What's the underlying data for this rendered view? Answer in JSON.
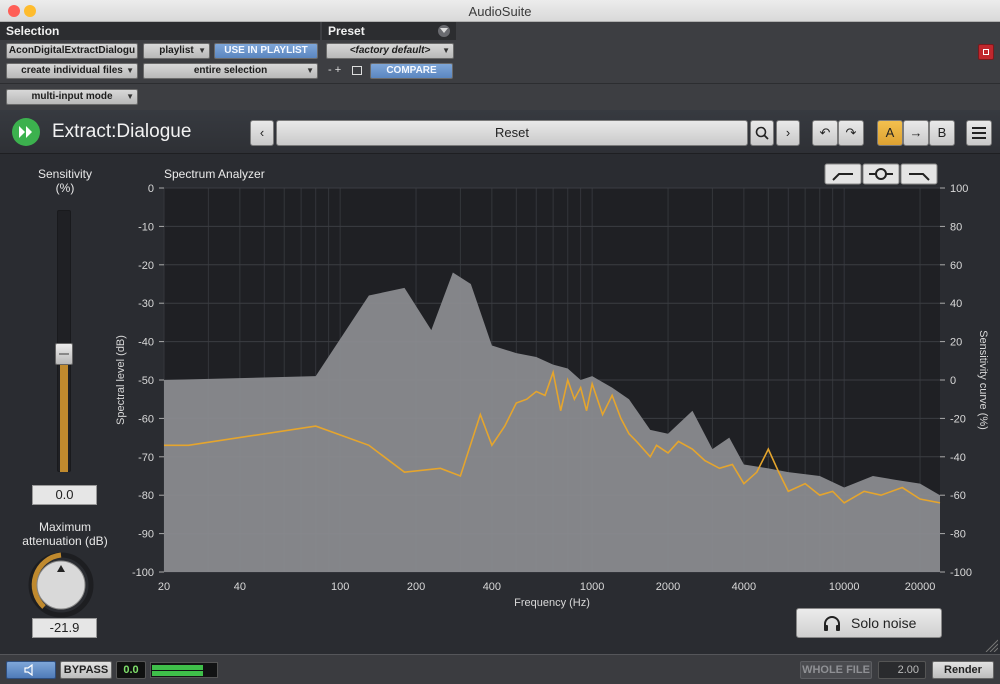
{
  "window": {
    "title": "AudioSuite"
  },
  "header": {
    "selection_label": "Selection",
    "preset_label": "Preset",
    "plugin_select": "AconDigitalExtractDialogu",
    "playlist_select": "playlist",
    "use_in_playlist": "USE IN PLAYLIST",
    "file_mode": "create individual files",
    "selection_mode": "entire selection",
    "preset_select": "<factory default>",
    "preset_controls": "- +",
    "compare": "COMPARE",
    "input_mode": "multi-input mode"
  },
  "plugin": {
    "name": "Extract:Dialogue",
    "preset_name": "Reset",
    "ab": {
      "a": "A",
      "arrow": "→",
      "b": "B"
    },
    "sensitivity": {
      "label_line1": "Sensitivity",
      "label_line2": "(%)",
      "value": "0.0",
      "level": 0.45
    },
    "max_attenuation": {
      "label_line1": "Maximum",
      "label_line2": "attenuation (dB)",
      "value": "-21.9"
    },
    "solo_noise": "Solo noise"
  },
  "chart_data": {
    "type": "area",
    "title": "Spectrum Analyzer",
    "xlabel": "Frequency (Hz)",
    "ylabel": "Spectral level (dB)",
    "y2label": "Sensitivity curve (%)",
    "x_scale": "log",
    "xlim": [
      20,
      24000
    ],
    "ylim": [
      -100,
      0
    ],
    "y2lim": [
      -100,
      100
    ],
    "x_ticks": [
      {
        "v": 20,
        "label": "20"
      },
      {
        "v": 40,
        "label": "40"
      },
      {
        "v": 100,
        "label": "100"
      },
      {
        "v": 200,
        "label": "200"
      },
      {
        "v": 400,
        "label": "400"
      },
      {
        "v": 1000,
        "label": "1000"
      },
      {
        "v": 2000,
        "label": "2000"
      },
      {
        "v": 4000,
        "label": "4000"
      },
      {
        "v": 10000,
        "label": "10000"
      },
      {
        "v": 20000,
        "label": "20000"
      }
    ],
    "y_ticks": [
      "0",
      "-10",
      "-20",
      "-30",
      "-40",
      "-50",
      "-60",
      "-70",
      "-80",
      "-90",
      "-100"
    ],
    "y2_ticks": [
      "100",
      "80",
      "60",
      "40",
      "20",
      "0",
      "-20",
      "-40",
      "-60",
      "-80",
      "-100"
    ],
    "grid": true,
    "series": [
      {
        "color": "#8a8b8f",
        "x": [
          20,
          80,
          130,
          180,
          230,
          280,
          330,
          400,
          500,
          600,
          700,
          800,
          900,
          1000,
          1200,
          1400,
          1700,
          2000,
          2500,
          3000,
          3500,
          4000,
          5000,
          6000,
          8000,
          10000,
          13000,
          16000,
          20000,
          24000
        ],
        "values": [
          -50,
          -49,
          -28,
          -26,
          -37,
          -22,
          -25,
          -41,
          -43,
          -44,
          -46,
          -47,
          -50,
          -49,
          -52,
          -55,
          -63,
          -64,
          -58,
          -68,
          -65,
          -72,
          -73,
          -74,
          -75,
          -78,
          -75,
          -76,
          -77,
          -80
        ]
      },
      {
        "color": "#e5a52d",
        "x": [
          20,
          25,
          80,
          130,
          180,
          250,
          300,
          360,
          400,
          450,
          500,
          550,
          600,
          650,
          700,
          750,
          800,
          850,
          900,
          950,
          1000,
          1100,
          1200,
          1300,
          1400,
          1500,
          1700,
          1800,
          2000,
          2200,
          2500,
          2800,
          3200,
          3600,
          4000,
          4500,
          5000,
          5500,
          6000,
          7000,
          8000,
          9000,
          10000,
          12000,
          14000,
          17000,
          20000,
          24000
        ],
        "values": [
          -67,
          -67,
          -62,
          -67,
          -74,
          -73,
          -75,
          -59,
          -67,
          -62,
          -56,
          -55,
          -53,
          -54,
          -48,
          -58,
          -50,
          -55,
          -52,
          -58,
          -51,
          -59,
          -54,
          -60,
          -64,
          -66,
          -70,
          -67,
          -69,
          -66,
          -68,
          -71,
          -73,
          -72,
          -77,
          -74,
          -68,
          -74,
          -79,
          -77,
          -80,
          -79,
          -82,
          -79,
          -80,
          -78,
          -81,
          -82
        ]
      }
    ]
  },
  "bottom": {
    "bypass": "BYPASS",
    "meter_value": "0.0",
    "meter_level": 0.8,
    "whole_file": "WHOLE FILE",
    "handle": "2.00",
    "render": "Render"
  },
  "colors": {
    "accent": "#e5a52d",
    "logo": "#3cb14e",
    "blue_button": "#5b86c0"
  }
}
